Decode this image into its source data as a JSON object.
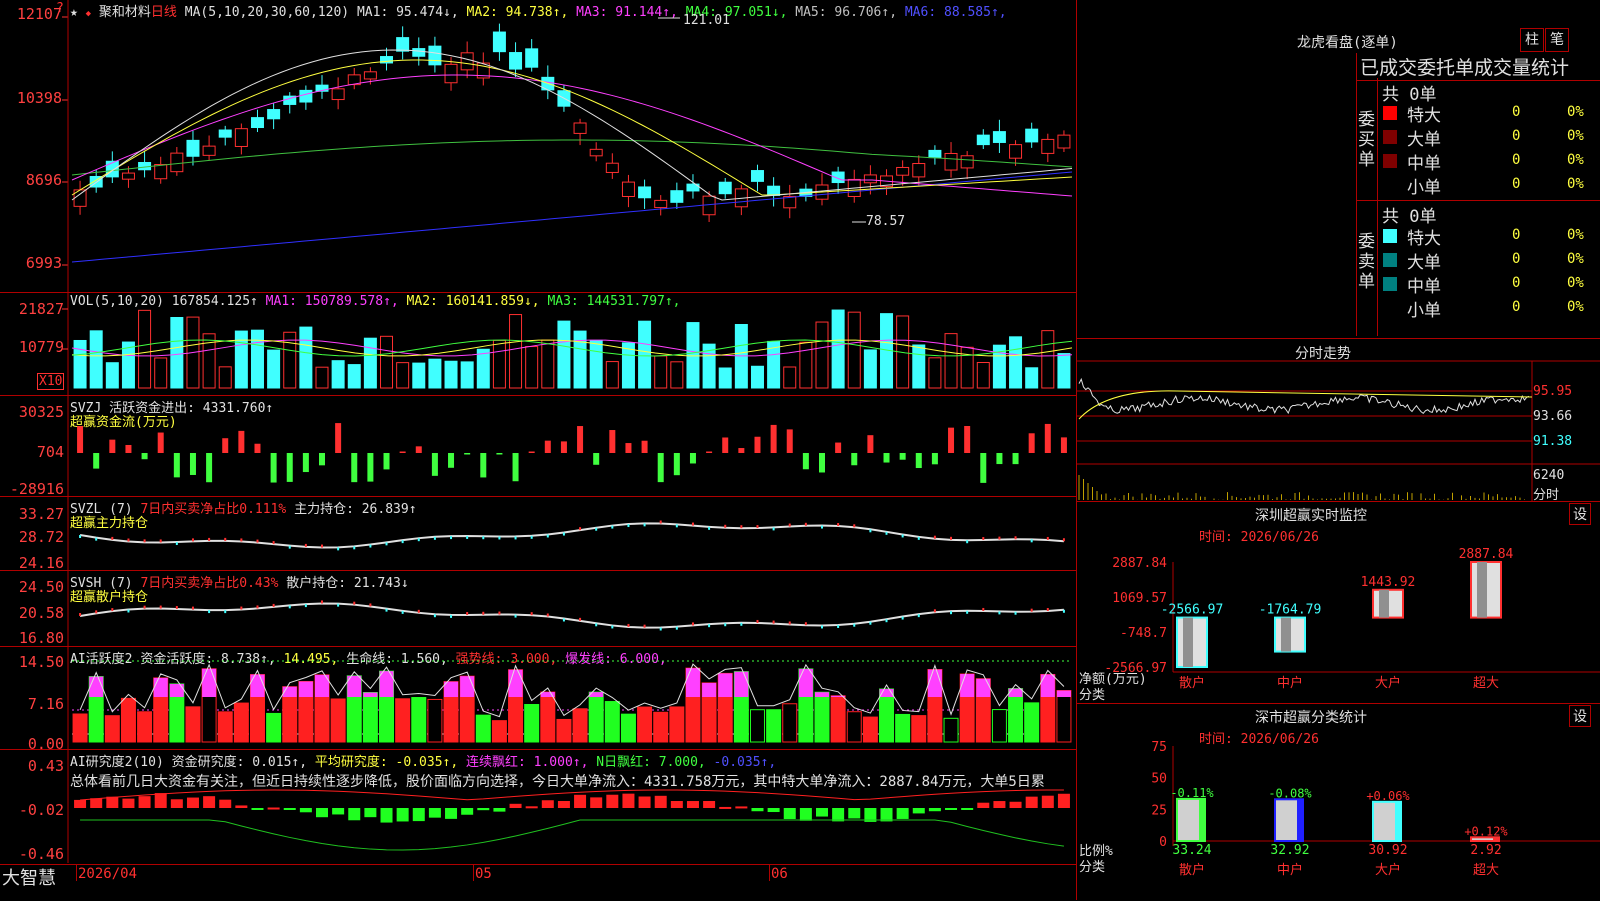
{
  "main": {
    "logo_glyph": "?",
    "star": "★",
    "star_flag": "◆",
    "stock_name": "聚和材料",
    "period": "日线",
    "ma_prefix": "MA(5,10,20,30,60,120)",
    "ma": [
      {
        "label": "MA1: 95.474↓",
        "color": "#e0e0e0"
      },
      {
        "label": "MA2: 94.738↑",
        "color": "#ffff40"
      },
      {
        "label": "MA3: 91.144↑",
        "color": "#ff40ff"
      },
      {
        "label": "MA4: 97.051↓",
        "color": "#40ff40"
      },
      {
        "label": "MA5: 96.706↑",
        "color": "#c0c0c0"
      },
      {
        "label": "MA6: 88.585↑",
        "color": "#5050ff"
      }
    ],
    "y_ticks": [
      "12107",
      "10398",
      "8696",
      "6993"
    ],
    "high_mark": "121.01",
    "low_mark": "78.57",
    "x_ticks": [
      "2026/04",
      "05",
      "06"
    ]
  },
  "vol": {
    "header": "VOL(5,10,20)",
    "value": "167854.125↑",
    "ma": [
      {
        "label": "MA1: 150789.578↑",
        "color": "#ff40ff"
      },
      {
        "label": "MA2: 160141.859↓",
        "color": "#ffff40"
      },
      {
        "label": "MA3: 144531.797↑",
        "color": "#40ff40"
      }
    ],
    "y_ticks": [
      "21827",
      "10779"
    ],
    "unit": "X10"
  },
  "svzj": {
    "header": "SVZJ",
    "label": "活跃资金进出: 4331.760↑",
    "sub": "超赢资金流(万元)",
    "y_ticks": [
      "30325",
      "704",
      "-28916"
    ]
  },
  "svzl": {
    "header": "SVZL (7)",
    "label1": "7日内买卖净占比0.111%",
    "label2": "主力持仓: 26.839↑",
    "sub": "超赢主力持仓",
    "y_ticks": [
      "33.27",
      "28.72",
      "24.16"
    ]
  },
  "svsh": {
    "header": "SVSH (7)",
    "label1": "7日内买卖净占比0.43%",
    "label2": "散户持仓: 21.743↓",
    "sub": "超赢散户持仓",
    "y_ticks": [
      "24.50",
      "20.58",
      "16.80"
    ]
  },
  "ai_active": {
    "header": "AI活跃度2",
    "items": [
      {
        "label": "资金活跃度: 8.738↑",
        "color": "#e0e0e0"
      },
      {
        "label": "14.495",
        "color": "#ffff40"
      },
      {
        "label": "生命线: 1.560",
        "color": "#e0e0e0"
      },
      {
        "label": "强势线: 3.000",
        "color": "#ff3030"
      },
      {
        "label": "爆发线: 6.000",
        "color": "#ff40ff"
      }
    ],
    "y_ticks": [
      "14.50",
      "7.16",
      "0.00"
    ]
  },
  "ai_research": {
    "header": "AI研究度2(10)",
    "items": [
      {
        "label": "资金研究度: 0.015↑",
        "color": "#e0e0e0"
      },
      {
        "label": "平均研究度: -0.035↑",
        "color": "#ffff40"
      },
      {
        "label": "连续飘红: 1.000↑",
        "color": "#ff40ff"
      },
      {
        "label": "N日飘红: 7.000",
        "color": "#40ff40"
      },
      {
        "label": "-0.035↑",
        "color": "#5050ff"
      }
    ],
    "summary": "总体看前几日大资金有关注，但近日持续性逐步降低，股价面临方向选择，今日大单净流入：4331.758万元，其中特大单净流入：2887.84万元，大单5日累",
    "y_ticks": [
      "0.43",
      "-0.02",
      "-0.46"
    ]
  },
  "bottom_logo": "大智慧",
  "dragon": {
    "title": "龙虎看盘(逐单)",
    "btn_bar": "柱",
    "btn_pen": "笔",
    "tabs": "已成交委托单成交量统计",
    "buy_label": "委买单",
    "sell_label": "委卖单",
    "buy_total": "共 0单",
    "sell_total": "共 0单",
    "rows": [
      "特大",
      "大单",
      "中单",
      "小单"
    ],
    "count": "0",
    "pct": "0%",
    "buy_colors": [
      "#ff0000",
      "#800000",
      "#800000",
      "#000000"
    ],
    "sell_colors": [
      "#40ffff",
      "#008080",
      "#008080",
      "#000000"
    ]
  },
  "intraday": {
    "title": "分时走势",
    "y_ticks": [
      "95.95",
      "93.66",
      "91.38"
    ],
    "vol_tick": "6240",
    "vol_label": "分时"
  },
  "sz_monitor": {
    "title": "深圳超赢实时监控",
    "btn": "设",
    "time": "时间: 2026/06/26",
    "y_ticks": [
      "2887.84",
      "1069.57",
      "-748.7",
      "-2566.97"
    ],
    "axis_label1": "净额(万元)",
    "axis_label2": "分类",
    "bars": [
      {
        "name": "散户",
        "value": -2566.97,
        "label": "-2566.97",
        "color": "#40ffff"
      },
      {
        "name": "中户",
        "value": -1764.79,
        "label": "-1764.79",
        "color": "#40ffff"
      },
      {
        "name": "大户",
        "value": 1443.92,
        "label": "1443.92",
        "color": "#ff3030"
      },
      {
        "name": "超大",
        "value": 2887.84,
        "label": "2887.84",
        "color": "#ff3030"
      }
    ]
  },
  "sz_class": {
    "title": "深市超赢分类统计",
    "btn": "设",
    "time": "时间: 2026/06/26",
    "y_ticks": [
      "75",
      "50",
      "25",
      "0"
    ],
    "axis_label1": "比例%",
    "axis_label2": "分类",
    "bars": [
      {
        "name": "散户",
        "value": 33.24,
        "label": "33.24",
        "delta": "-0.11%",
        "delta_color": "#40ff40",
        "fill": "#40ff40"
      },
      {
        "name": "中户",
        "value": 32.92,
        "label": "32.92",
        "delta": "-0.08%",
        "delta_color": "#40ff40",
        "fill": "#2020ff"
      },
      {
        "name": "大户",
        "value": 30.92,
        "label": "30.92",
        "delta": "+0.06%",
        "delta_color": "#ff3030",
        "fill": "#40ffff"
      },
      {
        "name": "超大",
        "value": 2.92,
        "label": "2.92",
        "delta": "+0.12%",
        "delta_color": "#ff3030",
        "fill": "#ff3030"
      }
    ]
  }
}
